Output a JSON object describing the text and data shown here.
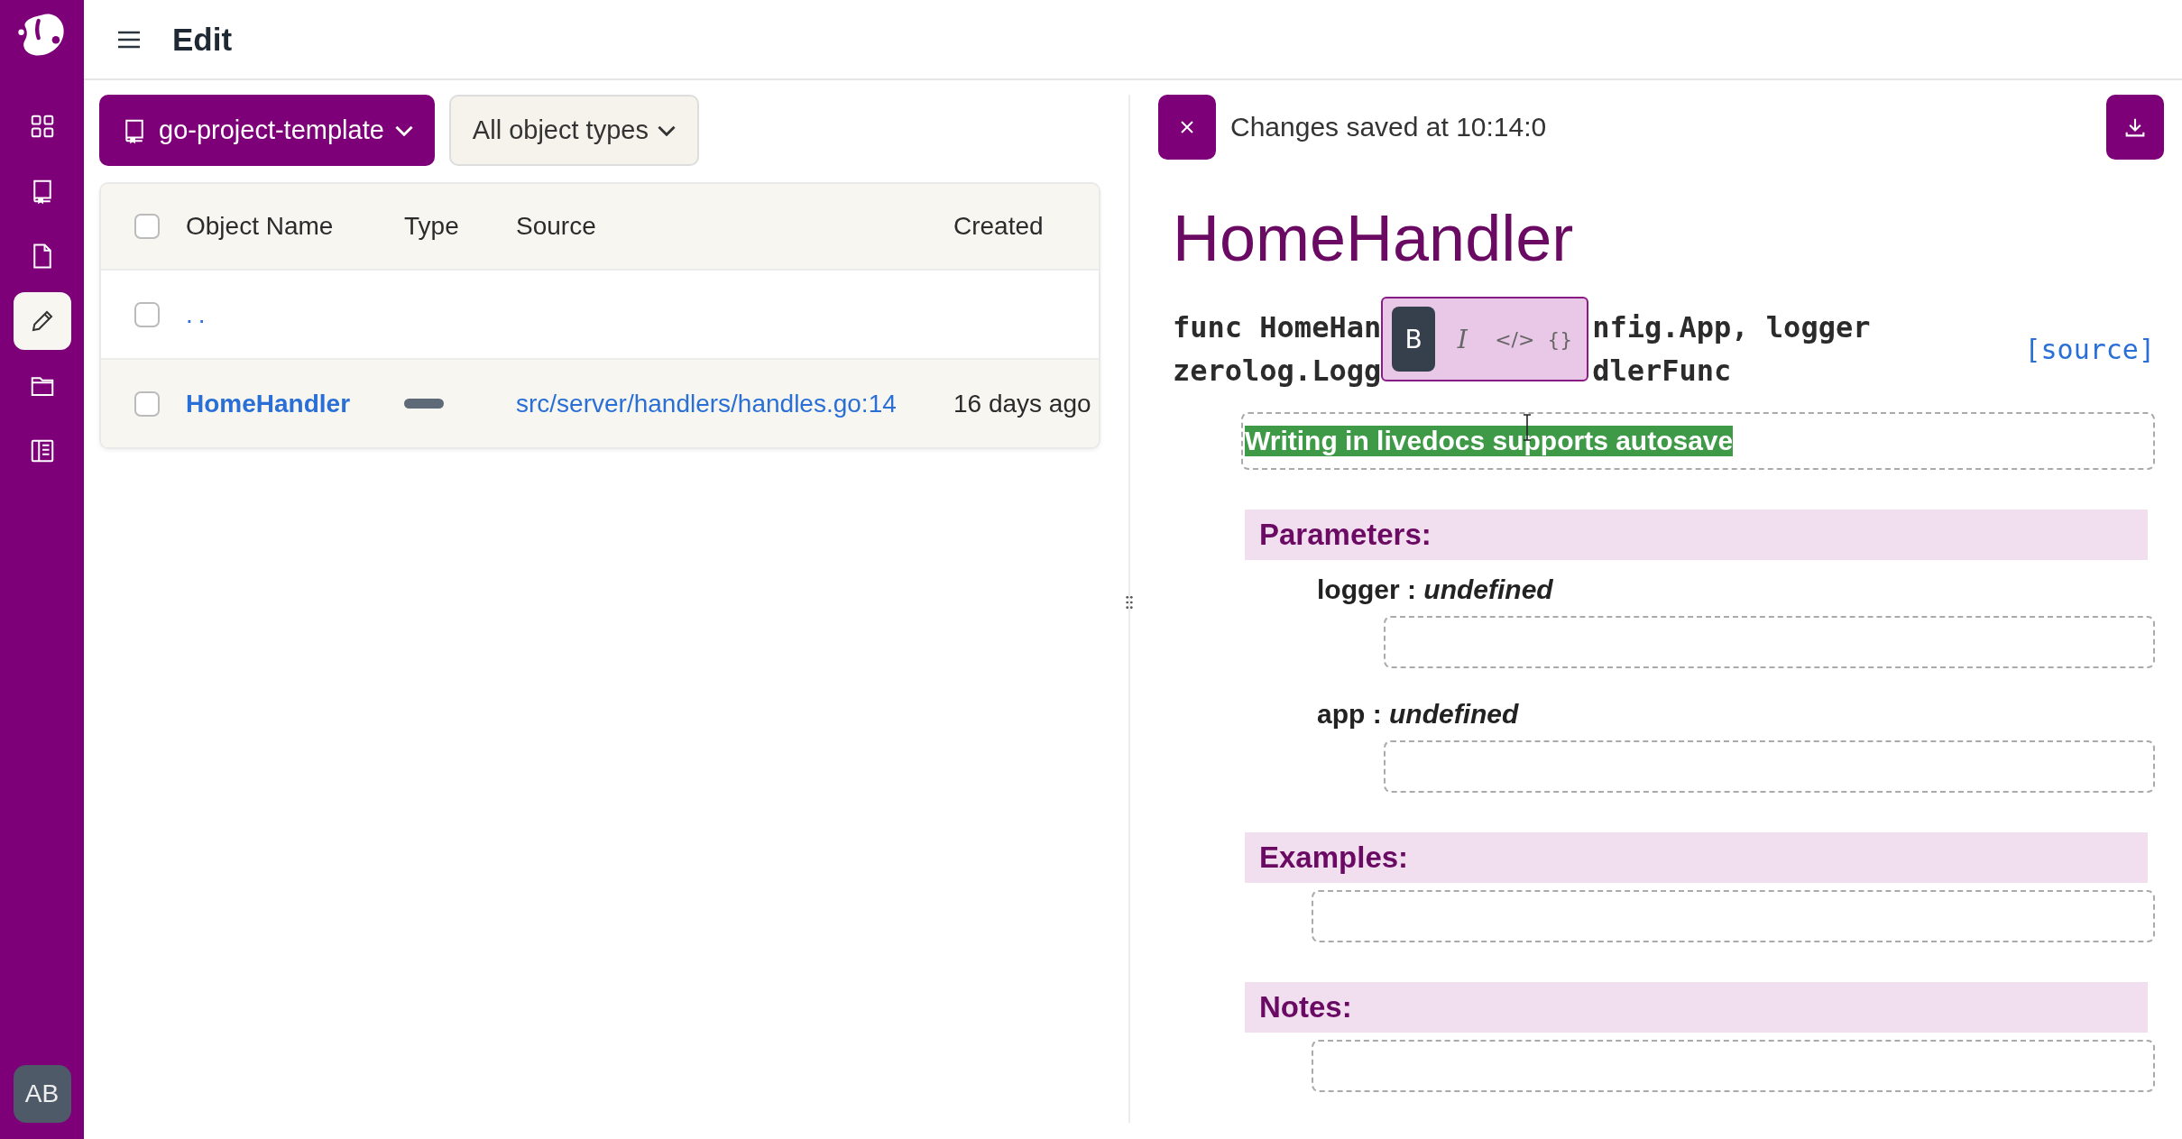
{
  "header": {
    "title": "Edit"
  },
  "sidebar": {
    "items": [
      {
        "kind": "grid",
        "selected": false
      },
      {
        "kind": "book",
        "selected": false
      },
      {
        "kind": "file",
        "selected": false
      },
      {
        "kind": "pencil",
        "selected": true
      },
      {
        "kind": "folder",
        "selected": false
      },
      {
        "kind": "panel",
        "selected": false
      }
    ],
    "avatar": "AB"
  },
  "toolbar": {
    "project": "go-project-template",
    "filter": "All object types"
  },
  "table": {
    "columns": [
      "Object Name",
      "Type",
      "Source",
      "Created"
    ],
    "all_checked": false,
    "rows": [
      {
        "kind": "parent",
        "checked": false,
        "name": ".."
      },
      {
        "kind": "object",
        "checked": false,
        "name": "HomeHandler",
        "source": "src/server/handlers/handles.go:14",
        "created": "16 days ago"
      }
    ]
  },
  "status": {
    "message": "Changes saved at 10:14:0"
  },
  "doc": {
    "title": "HomeHandler",
    "signature": [
      [
        "func HomeHan",
        "nfig.App, logger"
      ],
      [
        "zerolog.Logg",
        "dlerFunc"
      ]
    ],
    "source_link": "[source]",
    "format_toolbar": [
      {
        "kind": "bold",
        "label": "B",
        "selected": true
      },
      {
        "kind": "italic",
        "label": "I",
        "selected": false
      },
      {
        "kind": "code",
        "label": "</>",
        "selected": false
      },
      {
        "kind": "block",
        "label": "{}",
        "selected": false
      }
    ],
    "description": "Writing in livedocs supports autosave",
    "description_selected": true,
    "sections": [
      {
        "title": "Parameters:",
        "params": [
          {
            "name": "logger",
            "sep": ":",
            "type": "undefined"
          },
          {
            "name": "app",
            "sep": ":",
            "type": "undefined"
          }
        ]
      },
      {
        "title": "Examples:"
      },
      {
        "title": "Notes:"
      }
    ]
  }
}
